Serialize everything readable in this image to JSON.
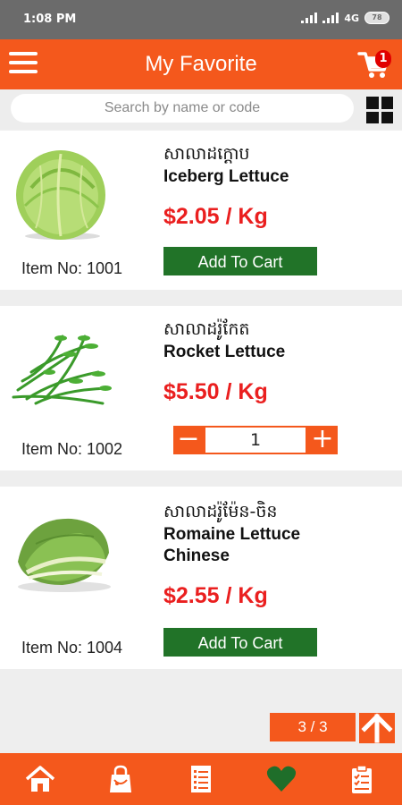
{
  "status_bar": {
    "time": "1:08 PM",
    "network": "4G",
    "battery": "78"
  },
  "app_bar": {
    "title": "My Favorite",
    "cart_count": "1"
  },
  "search": {
    "placeholder": "Search by name or code"
  },
  "products": [
    {
      "khmer_name": "សាលាដក្ដោប",
      "name": "Iceberg Lettuce",
      "price": "$2.05 / Kg",
      "item_no": "Item No: 1001",
      "action": "Add To Cart"
    },
    {
      "khmer_name": "សាលាដរ៉ូកែត",
      "name": "Rocket Lettuce",
      "price": "$5.50 / Kg",
      "item_no": "Item No: 1002",
      "quantity": "1"
    },
    {
      "khmer_name": "សាលាដរ៉ូម៉ែន-ចិន",
      "name_line1": "Romaine Lettuce",
      "name_line2": "Chinese",
      "price": "$2.55 / Kg",
      "item_no": "Item No: 1004",
      "action": "Add To Cart"
    }
  ],
  "pagination": {
    "label": "3 / 3"
  },
  "colors": {
    "primary": "#f4581c",
    "price": "#ea1f1f",
    "add_to_cart": "#217328"
  },
  "bottom_nav": [
    "home-icon",
    "shopping-bag-icon",
    "list-icon",
    "heart-icon",
    "clipboard-check-icon"
  ]
}
